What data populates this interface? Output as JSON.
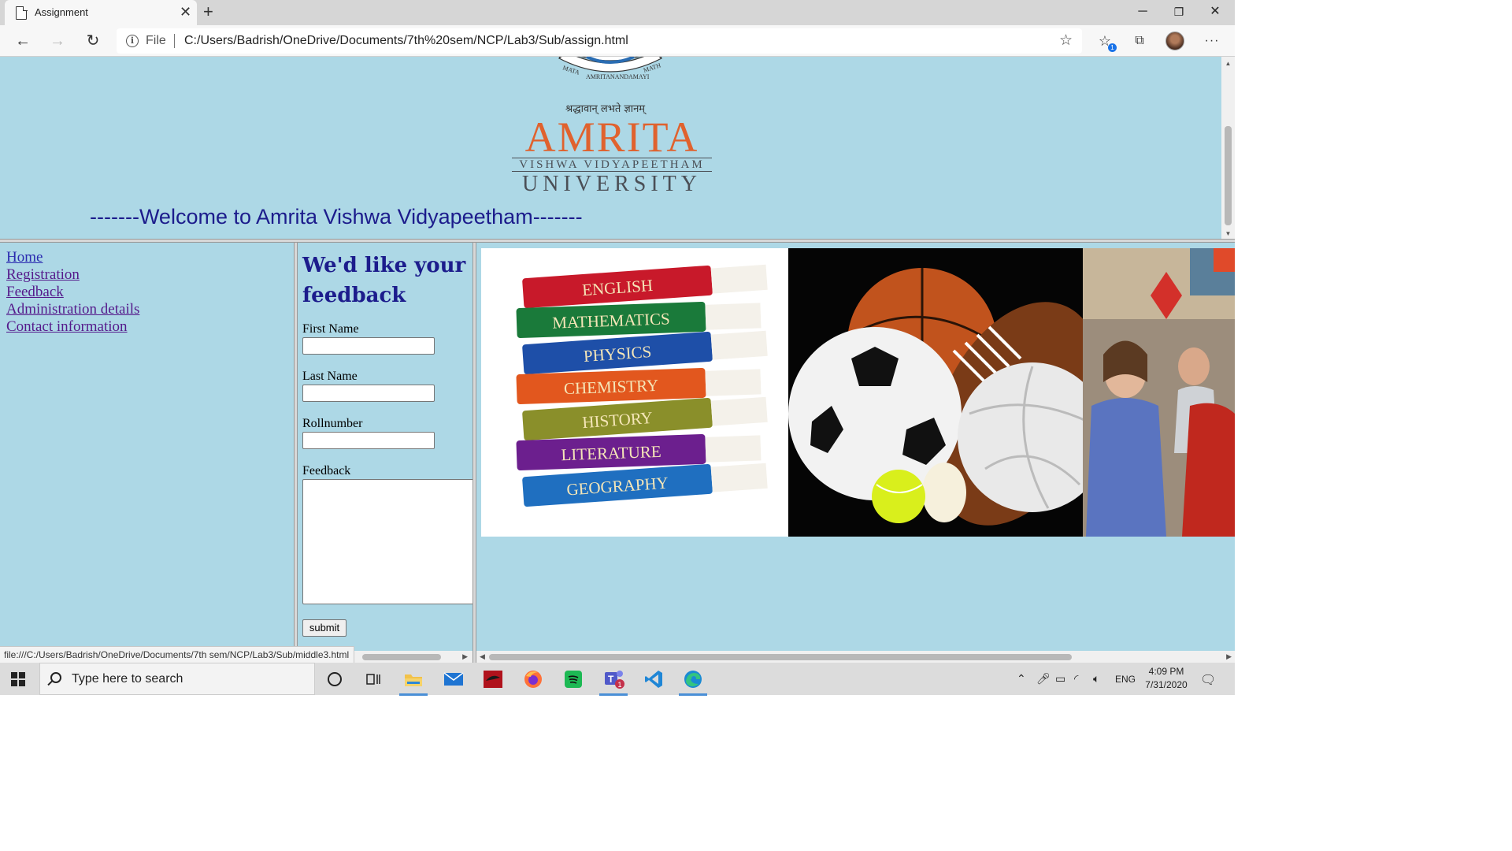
{
  "browser": {
    "tab_title": "Assignment",
    "tab_close": "✕",
    "new_tab": "+",
    "window_controls": {
      "minimize": "─",
      "restore": "❐",
      "close": "✕"
    },
    "nav": {
      "back": "←",
      "forward": "→",
      "refresh": "↻"
    },
    "address": {
      "scheme_label": "File",
      "url": "C:/Users/Badrish/OneDrive/Documents/7th%20sem/NCP/Lab3/Sub/assign.html"
    },
    "toolbar_icons": [
      "star-outline-icon",
      "favorites-icon",
      "collections-icon",
      "profile-avatar",
      "more-icon"
    ],
    "more": "···",
    "status_url": "file:///C:/Users/Badrish/OneDrive/Documents/7th sem/NCP/Lab3/Sub/middle3.html"
  },
  "header_frame": {
    "emblem_text": [
      "MATA",
      "AMRITANANDAMAYI",
      "MATH"
    ],
    "motto": "श्रद्धावान् लभते ज्ञानम्",
    "logo_main": "AMRITA",
    "logo_sub": "VISHWA VIDYAPEETHAM",
    "logo_bottom": "UNIVERSITY",
    "welcome": "-------Welcome to Amrita Vishwa Vidyapeetham-------"
  },
  "menu_frame": {
    "links": [
      {
        "label": "Home",
        "visited": false
      },
      {
        "label": "Registration",
        "visited": true
      },
      {
        "label": "Feedback",
        "visited": true
      },
      {
        "label": "Administration details",
        "visited": true
      },
      {
        "label": "Contact information",
        "visited": true
      }
    ]
  },
  "feedback_frame": {
    "heading": "We'd like your feedback",
    "fields": [
      {
        "label": "First Name",
        "value": ""
      },
      {
        "label": "Last Name",
        "value": ""
      },
      {
        "label": "Rollnumber",
        "value": ""
      }
    ],
    "textarea_label": "Feedback",
    "submit_label": "submit"
  },
  "content_frame": {
    "banner_books": [
      "ENGLISH",
      "MATHEMATICS",
      "PHYSICS",
      "CHEMISTRY",
      "HISTORY",
      "LITERATURE",
      "GEOGRAPHY"
    ],
    "book_colors": [
      "#c8192a",
      "#1a7a3a",
      "#1e4fa8",
      "#e2571e",
      "#8a8f2a",
      "#6c1f8e",
      "#1f6fc0"
    ]
  },
  "taskbar": {
    "search_placeholder": "Type here to search",
    "apps": [
      "cortana-icon",
      "task-view-icon",
      "file-explorer-icon",
      "mail-icon",
      "app-icon",
      "firefox-icon",
      "spotify-icon",
      "teams-icon",
      "vscode-icon",
      "edge-icon"
    ],
    "teams_badge": "1",
    "language": "ENG",
    "time": "4:09 PM",
    "date": "7/31/2020"
  }
}
